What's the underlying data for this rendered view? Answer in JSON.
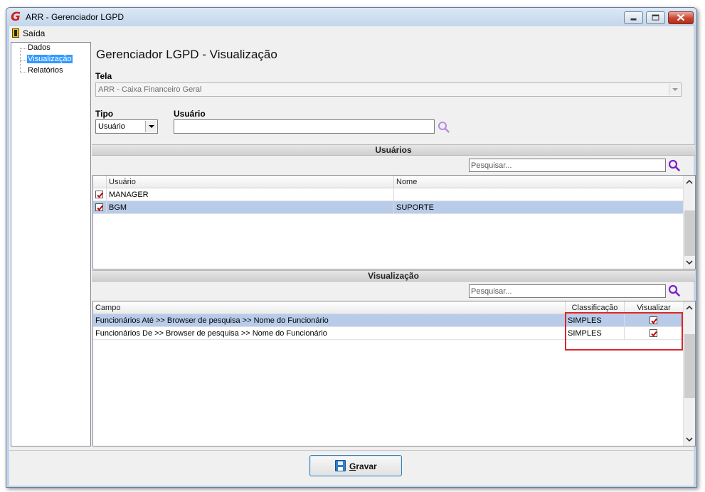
{
  "window": {
    "title": "ARR - Gerenciador LGPD"
  },
  "menu": {
    "exit_label": "Saída"
  },
  "tree": {
    "items": [
      "Dados",
      "Visualização",
      "Relatórios"
    ],
    "selected": "Visualização"
  },
  "page": {
    "title": "Gerenciador LGPD - Visualização"
  },
  "form": {
    "tela_label": "Tela",
    "tela_value": "ARR - Caixa Financeiro Geral",
    "tipo_label": "Tipo",
    "tipo_value": "Usuário",
    "usuario_label": "Usuário",
    "usuario_value": ""
  },
  "usuarios_section": {
    "title": "Usuários",
    "search_placeholder": "Pesquisar...",
    "columns": [
      "Usuário",
      "Nome"
    ],
    "rows": [
      {
        "checked": true,
        "usuario": "MANAGER",
        "nome": "",
        "selected": false
      },
      {
        "checked": true,
        "usuario": "BGM",
        "nome": "SUPORTE",
        "selected": true
      }
    ]
  },
  "visualizacao_section": {
    "title": "Visualização",
    "search_placeholder": "Pesquisar...",
    "columns": [
      "Campo",
      "Classificação",
      "Visualizar"
    ],
    "rows": [
      {
        "campo": "Funcionários Até >> Browser de pesquisa >> Nome do Funcionário",
        "classificacao": "SIMPLES",
        "visualizar": true,
        "selected": true
      },
      {
        "campo": "Funcionários De >> Browser de pesquisa >> Nome do Funcionário",
        "classificacao": "SIMPLES",
        "visualizar": true,
        "selected": false
      }
    ]
  },
  "footer": {
    "save_label_first": "G",
    "save_label_rest": "ravar"
  },
  "colors": {
    "accent": "#3399ff",
    "row_selected": "#b8cce9",
    "highlight": "#d9262c",
    "search_icon": "#7a1fc9",
    "check": "#cc0000"
  }
}
